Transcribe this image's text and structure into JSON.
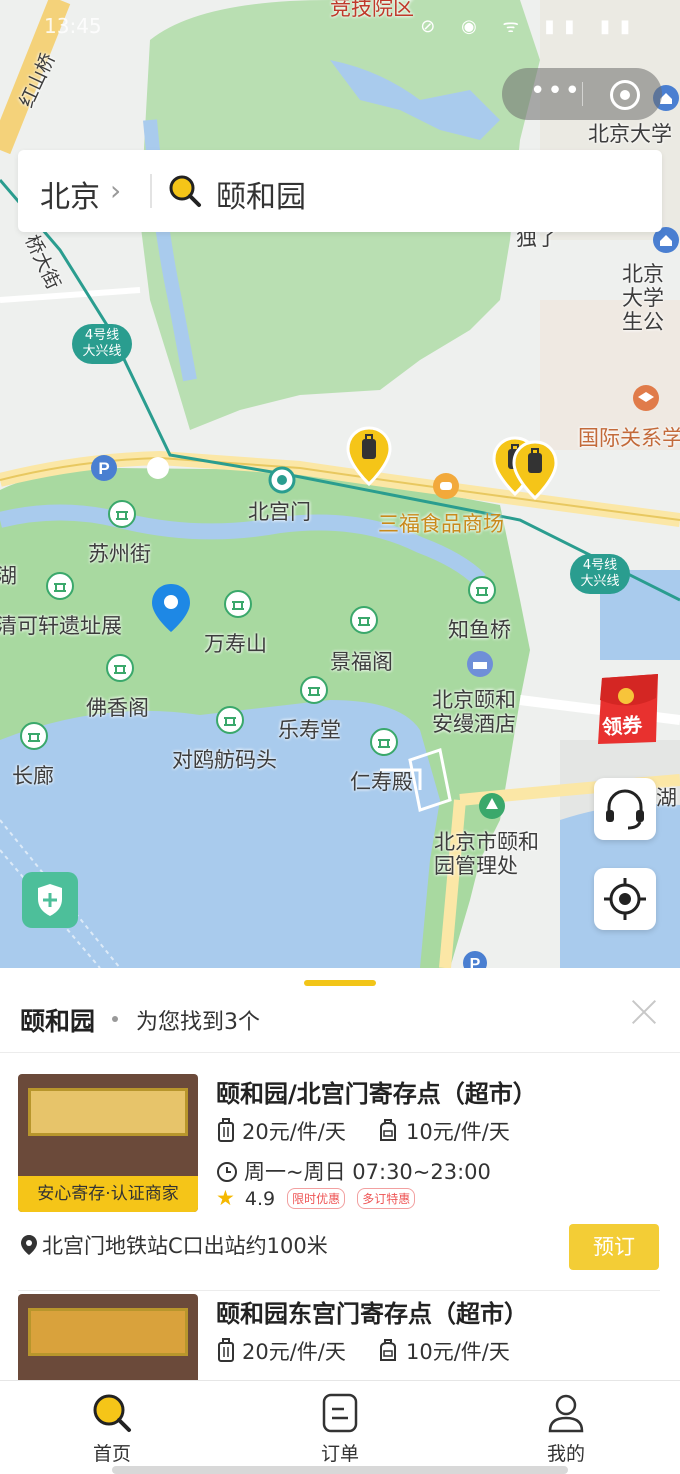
{
  "status_bar": {
    "time": "13:45",
    "icons": "⊘ ◉ ᯤ ▮▮ ▮▮"
  },
  "search": {
    "city": "北京",
    "query": "颐和园"
  },
  "map_labels": {
    "top_partial": "竞技院区",
    "hongshan_bridge": "红山桥",
    "pku": "北京大学",
    "pku_partial": "独了",
    "pku_student": "北京大学生公",
    "bridge_street": "桥大街",
    "line4_a": "4号线\n大兴线",
    "intl_relations": "国际关系学",
    "beigongmen": "北宫门",
    "sanfu": "三福食品商场",
    "line4_b": "4号线\n大兴线",
    "suzhou_street": "苏州街",
    "lake_partial": "湖",
    "qingkexuan": "清可轩遗址展",
    "wanshoushan": "万寿山",
    "zhiyuqiao": "知鱼桥",
    "jingfuge": "景福阁",
    "foxiangge": "佛香阁",
    "hotel": "北京颐和\n安缦酒店",
    "leshoutang": "乐寿堂",
    "duiou": "对鸥舫码头",
    "changlang": "长廊",
    "renshoudian": "仁寿殿",
    "admin": "北京市颐和\n园管理处",
    "east_lake_partial": "湖"
  },
  "coupon_label": "领券",
  "sheet": {
    "title": "颐和园",
    "count": "为您找到3个",
    "cards": [
      {
        "name": "颐和园/北宫门寄存点（超市）",
        "price_suitcase": "20元/件/天",
        "price_bag": "10元/件/天",
        "hours": "周一~周日 07:30~23:00",
        "badge": "安心寄存·认证商家",
        "rating": "4.9",
        "tag1": "限时优惠",
        "tag2": "多订特惠",
        "address": "北宫门地铁站C口出站约100米",
        "book": "预订"
      },
      {
        "name": "颐和园东宫门寄存点（超市）",
        "price_suitcase": "20元/件/天",
        "price_bag": "10元/件/天"
      }
    ]
  },
  "tabs": [
    {
      "label": "首页"
    },
    {
      "label": "订单"
    },
    {
      "label": "我的"
    }
  ],
  "colors": {
    "accent": "#f2c518",
    "park_green": "#a8d9a0",
    "water": "#a9cbed",
    "road": "#fbe7a6"
  }
}
